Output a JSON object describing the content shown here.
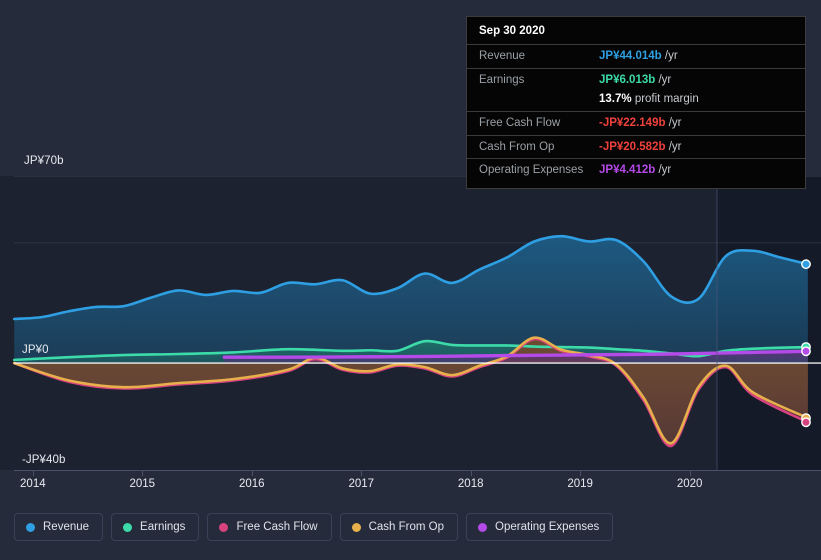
{
  "chart_data": {
    "type": "area",
    "title": "",
    "xlabel": "",
    "ylabel": "",
    "currency": "JP¥",
    "ylim": [
      -40,
      70
    ],
    "grid": true,
    "legend_position": "bottom",
    "y_ticks": [
      {
        "label": "JP¥70b",
        "value": 70
      },
      {
        "label": "JP¥0",
        "value": 0
      },
      {
        "label": "-JP¥40b",
        "value": -40
      }
    ],
    "x_ticks": [
      "2014",
      "2015",
      "2016",
      "2017",
      "2018",
      "2019",
      "2020"
    ],
    "x_range": [
      2013.7,
      2021.2
    ],
    "forecast_start": "2020.25",
    "series": [
      {
        "name": "Revenue",
        "color": "#2f9fe3",
        "fill": "#1d5c85",
        "x": [
          2013.83,
          2014.08,
          2014.33,
          2014.58,
          2014.83,
          2015.08,
          2015.33,
          2015.58,
          2015.83,
          2016.08,
          2016.33,
          2016.58,
          2016.83,
          2017.08,
          2017.33,
          2017.58,
          2017.83,
          2018.08,
          2018.33,
          2018.58,
          2018.83,
          2019.08,
          2019.33,
          2019.58,
          2019.83,
          2020.08,
          2020.33,
          2020.58,
          2020.83,
          2021.08
        ],
        "values": [
          16.5,
          17.2,
          19.4,
          21.0,
          21.3,
          24.5,
          27.2,
          25.5,
          27.0,
          26.3,
          30.0,
          29.5,
          31.0,
          26.0,
          28.0,
          33.5,
          30.0,
          35.0,
          39.5,
          45.5,
          47.5,
          45.5,
          46.0,
          38.0,
          25.0,
          24.0,
          40.0,
          42.0,
          39.5,
          37.0
        ]
      },
      {
        "name": "Earnings",
        "color": "#3ddba9",
        "fill": "#1f6f68",
        "x": [
          2013.83,
          2014.33,
          2014.83,
          2015.33,
          2015.83,
          2016.33,
          2016.83,
          2017.08,
          2017.33,
          2017.58,
          2017.83,
          2018.08,
          2018.33,
          2018.58,
          2018.83,
          2019.08,
          2019.33,
          2019.58,
          2019.83,
          2020.08,
          2020.33,
          2020.58,
          2021.08
        ],
        "values": [
          1.2,
          2.2,
          3.0,
          3.4,
          4.0,
          5.2,
          4.6,
          4.8,
          4.6,
          8.2,
          6.8,
          6.6,
          6.6,
          6.2,
          6.0,
          5.8,
          5.2,
          4.6,
          3.6,
          2.6,
          4.6,
          5.4,
          6.013
        ]
      },
      {
        "name": "Free Cash Flow",
        "color": "#d6437f",
        "fill": "#6b2f45",
        "x": [
          2013.83,
          2014.33,
          2014.83,
          2015.33,
          2015.83,
          2016.33,
          2016.58,
          2016.83,
          2017.08,
          2017.33,
          2017.58,
          2017.83,
          2018.08,
          2018.33,
          2018.58,
          2018.83,
          2019.08,
          2019.33,
          2019.58,
          2019.83,
          2020.08,
          2020.33,
          2020.58,
          2021.08
        ],
        "values": [
          0.0,
          -7.0,
          -9.5,
          -8.0,
          -6.5,
          -3.0,
          1.5,
          -2.5,
          -3.5,
          -1.0,
          -2.0,
          -5.0,
          -1.5,
          2.0,
          9.0,
          4.5,
          2.5,
          -1.0,
          -14.0,
          -31.0,
          -10.0,
          -1.5,
          -12.0,
          -22.149
        ]
      },
      {
        "name": "Cash From Op",
        "color": "#e8b04b",
        "fill": "#6b4d30",
        "x": [
          2013.83,
          2014.33,
          2014.83,
          2015.33,
          2015.83,
          2016.33,
          2016.58,
          2016.83,
          2017.08,
          2017.33,
          2017.58,
          2017.83,
          2018.08,
          2018.33,
          2018.58,
          2018.83,
          2019.08,
          2019.33,
          2019.58,
          2019.83,
          2020.08,
          2020.33,
          2020.58,
          2021.08
        ],
        "values": [
          0.0,
          -6.5,
          -9.0,
          -7.5,
          -6.0,
          -2.5,
          2.0,
          -2.0,
          -3.0,
          -0.5,
          -1.5,
          -4.5,
          -1.0,
          2.5,
          9.5,
          5.0,
          3.0,
          -0.5,
          -13.0,
          -30.0,
          -9.0,
          -1.0,
          -11.0,
          -20.582
        ]
      },
      {
        "name": "Operating Expenses",
        "color": "#b44ae8",
        "fill": "#5a2f7a",
        "x": [
          2015.75,
          2016.33,
          2016.83,
          2017.33,
          2017.83,
          2018.33,
          2018.83,
          2019.33,
          2019.83,
          2020.33,
          2021.08
        ],
        "values": [
          2.2,
          2.2,
          2.3,
          2.4,
          2.6,
          2.8,
          3.0,
          3.2,
          3.4,
          3.8,
          4.412
        ]
      }
    ],
    "endpoints": [
      {
        "series": "Revenue",
        "value": 37.0
      },
      {
        "series": "Earnings",
        "value": 6.013
      },
      {
        "series": "Operating Expenses",
        "value": 4.412
      },
      {
        "series": "Cash From Op",
        "value": -20.582
      },
      {
        "series": "Free Cash Flow",
        "value": -22.149
      }
    ]
  },
  "tooltip": {
    "date": "Sep 30 2020",
    "rows": [
      {
        "label": "Revenue",
        "amount": "JP¥44.014b",
        "unit": "/yr",
        "color_class": "tt-rev"
      },
      {
        "label": "Earnings",
        "amount": "JP¥6.013b",
        "unit": "/yr",
        "color_class": "tt-earn"
      },
      {
        "label": "",
        "margin_num": "13.7%",
        "margin_text": "profit margin"
      },
      {
        "label": "Free Cash Flow",
        "amount": "-JP¥22.149b",
        "unit": "/yr",
        "color_class": "tt-neg"
      },
      {
        "label": "Cash From Op",
        "amount": "-JP¥20.582b",
        "unit": "/yr",
        "color_class": "tt-neg"
      },
      {
        "label": "Operating Expenses",
        "amount": "JP¥4.412b",
        "unit": "/yr",
        "color_class": "tt-opex"
      }
    ]
  },
  "legend": {
    "items": [
      {
        "label": "Revenue",
        "color": "#2f9fe3"
      },
      {
        "label": "Earnings",
        "color": "#3ddba9"
      },
      {
        "label": "Free Cash Flow",
        "color": "#d6437f"
      },
      {
        "label": "Cash From Op",
        "color": "#e8b04b"
      },
      {
        "label": "Operating Expenses",
        "color": "#b44ae8"
      }
    ]
  },
  "theme": {
    "background": "#252b3b",
    "plot_background": "#1c2230",
    "forecast_background": "#1a2030",
    "zero_line": "#ffffff",
    "grid_line": "#39405180",
    "axis_text": "#e8eaf0"
  }
}
